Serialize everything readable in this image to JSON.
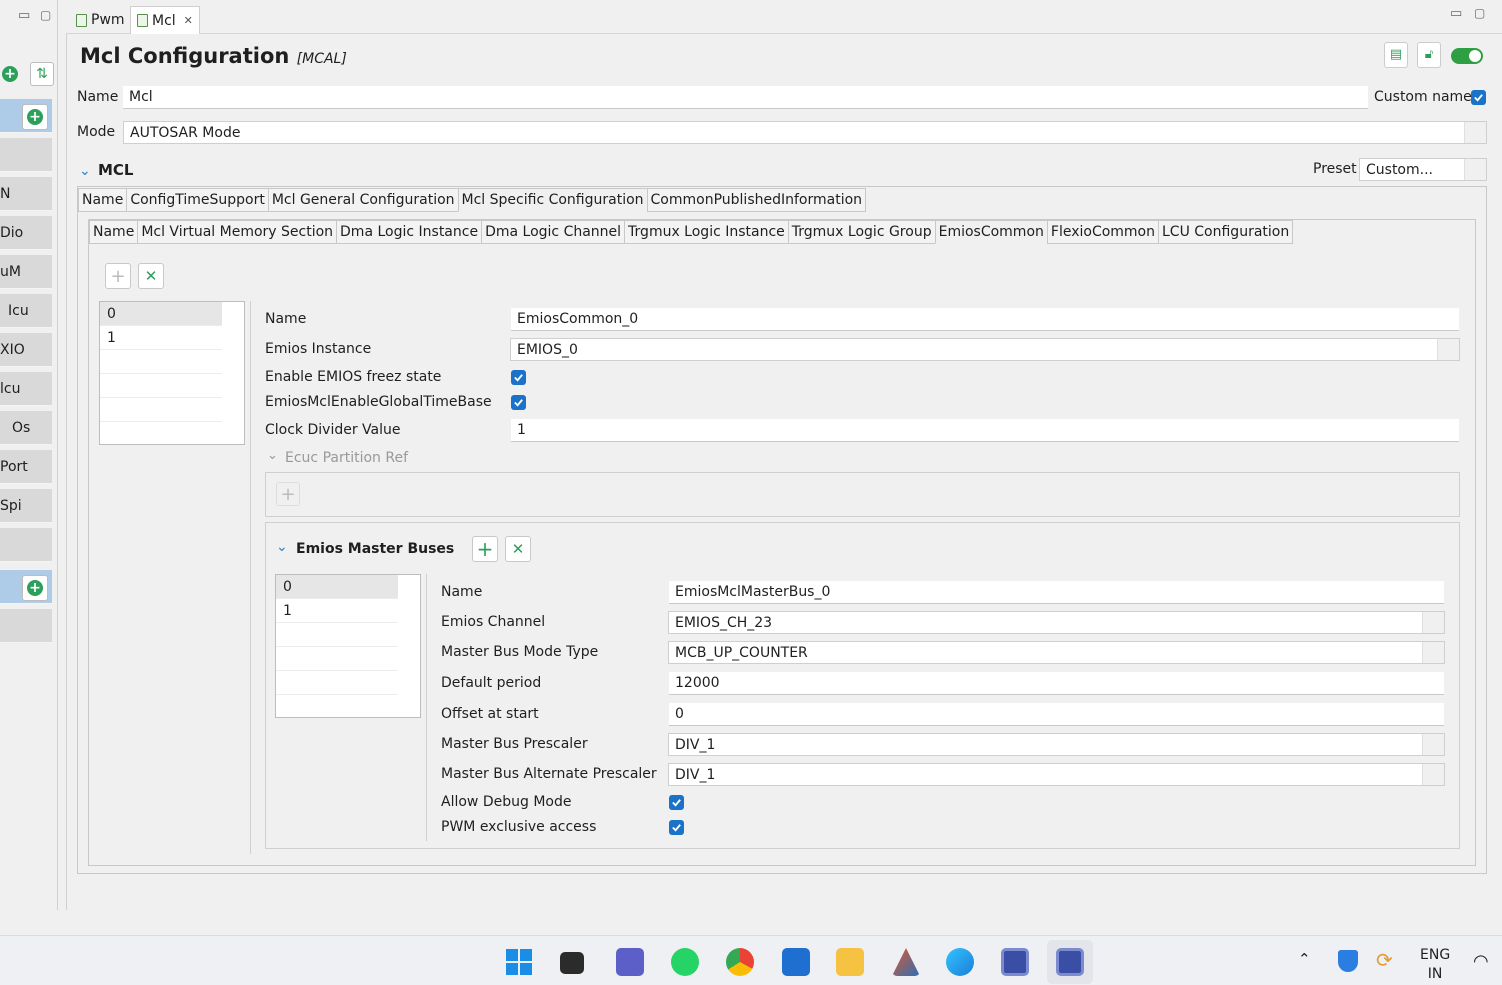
{
  "tabs": [
    {
      "label": "Pwm"
    },
    {
      "label": "Mcl"
    }
  ],
  "left_nav": [
    "N",
    "Dio",
    "uM",
    "Icu",
    "XIO",
    "lcu",
    "Os",
    "Port",
    "Spi"
  ],
  "header": {
    "title": "Mcl Configuration",
    "subtitle": "[MCAL]"
  },
  "name_field": {
    "label": "Name",
    "value": "Mcl",
    "custom_label": "Custom name"
  },
  "mode_field": {
    "label": "Mode",
    "value": "AUTOSAR Mode"
  },
  "section": {
    "title": "MCL",
    "preset_label": "Preset",
    "preset_value": "Custom..."
  },
  "outer_tabs": [
    "Name",
    "ConfigTimeSupport",
    "Mcl General Configuration",
    "Mcl Specific Configuration",
    "CommonPublishedInformation"
  ],
  "inner_tabs": [
    "Name",
    "Mcl Virtual Memory Section",
    "Dma Logic Instance",
    "Dma Logic Channel",
    "Trgmux Logic Instance",
    "Trgmux Logic Group",
    "EmiosCommon",
    "FlexioCommon",
    "LCU Configuration"
  ],
  "emios_list": [
    "0",
    "1"
  ],
  "emios": {
    "name_label": "Name",
    "name_value": "EmiosCommon_0",
    "instance_label": "Emios Instance",
    "instance_value": "EMIOS_0",
    "freeze_label": "Enable EMIOS freez state",
    "timebase_label": "EmiosMclEnableGlobalTimeBase",
    "divider_label": "Clock Divider Value",
    "divider_value": "1",
    "partition_label": "Ecuc Partition Ref"
  },
  "master_buses": {
    "title": "Emios Master Buses",
    "list": [
      "0",
      "1"
    ],
    "name_label": "Name",
    "name_value": "EmiosMclMasterBus_0",
    "channel_label": "Emios Channel",
    "channel_value": "EMIOS_CH_23",
    "mode_label": "Master Bus Mode Type",
    "mode_value": "MCB_UP_COUNTER",
    "period_label": "Default period",
    "period_value": "12000",
    "offset_label": "Offset at start",
    "offset_value": "0",
    "prescaler_label": "Master Bus Prescaler",
    "prescaler_value": "DIV_1",
    "alt_prescaler_label": "Master Bus Alternate Prescaler",
    "alt_prescaler_value": "DIV_1",
    "debug_label": "Allow Debug Mode",
    "pwm_label": "PWM exclusive access"
  },
  "taskbar": {
    "lang_top": "ENG",
    "lang_bottom": "IN"
  },
  "colors": {
    "accent": "#1a73c8",
    "green": "#2e9e5b",
    "selection": "#aecbe8"
  }
}
